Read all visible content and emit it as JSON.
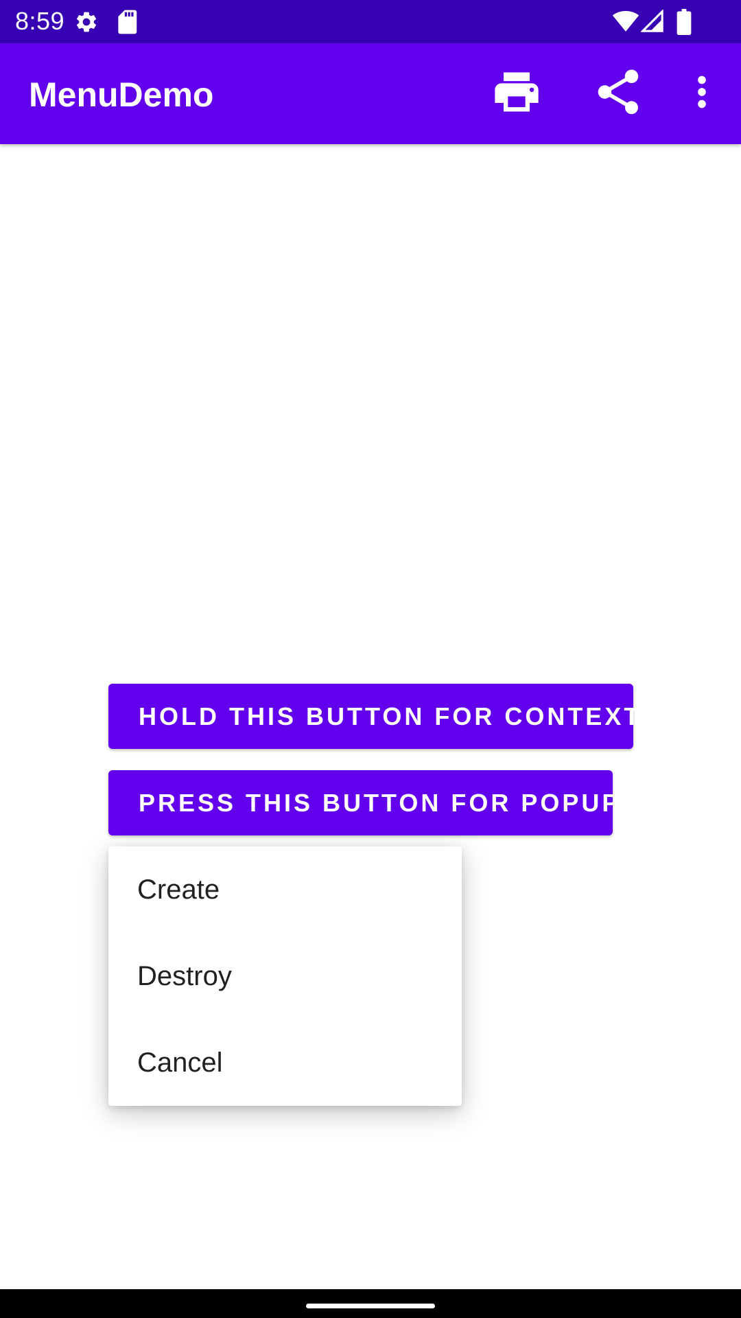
{
  "status_bar": {
    "time": "8:59",
    "icons": [
      "settings-gear-icon",
      "sd-card-icon",
      "wifi-icon",
      "cellular-signal-icon",
      "battery-icon"
    ]
  },
  "app_bar": {
    "title": "MenuDemo",
    "actions": [
      {
        "name": "print",
        "icon": "print-icon"
      },
      {
        "name": "share",
        "icon": "share-icon"
      },
      {
        "name": "more_options",
        "icon": "more-vert-icon"
      }
    ]
  },
  "buttons": {
    "context": "HOLD THIS BUTTON FOR CONTEXT",
    "popup": "PRESS THIS BUTTON FOR POPUP"
  },
  "popup_menu": {
    "items": [
      "Create",
      "Destroy",
      "Cancel"
    ]
  },
  "colors": {
    "status_bar": "#3700b3",
    "primary": "#6200ee",
    "background": "#ffffff",
    "on_primary": "#ffffff",
    "menu_text": "#202124"
  }
}
